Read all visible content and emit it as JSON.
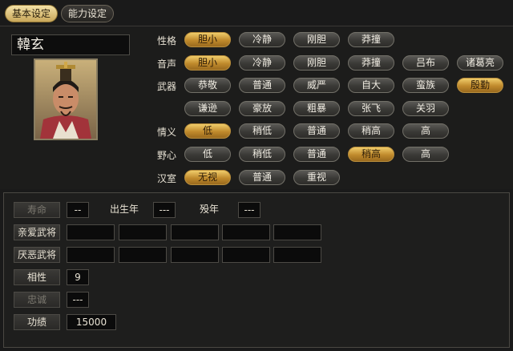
{
  "tabs": [
    {
      "label": "基本设定",
      "active": true
    },
    {
      "label": "能力设定",
      "active": false
    }
  ],
  "name": "韓玄",
  "portrait": "officer-portrait",
  "attributes": [
    {
      "label": "性格",
      "options": [
        {
          "text": "胆小",
          "selected": true
        },
        {
          "text": "冷静",
          "selected": false
        },
        {
          "text": "刚胆",
          "selected": false
        },
        {
          "text": "莽撞",
          "selected": false
        }
      ]
    },
    {
      "label": "音声",
      "options": [
        {
          "text": "胆小",
          "selected": true
        },
        {
          "text": "冷静",
          "selected": false
        },
        {
          "text": "刚胆",
          "selected": false
        },
        {
          "text": "莽撞",
          "selected": false
        },
        {
          "text": "吕布",
          "selected": false
        },
        {
          "text": "诸葛亮",
          "selected": false
        }
      ]
    },
    {
      "label": "武器",
      "options": [
        {
          "text": "恭敬",
          "selected": false
        },
        {
          "text": "普通",
          "selected": false
        },
        {
          "text": "威严",
          "selected": false
        },
        {
          "text": "自大",
          "selected": false
        },
        {
          "text": "蛮族",
          "selected": false
        },
        {
          "text": "殷勤",
          "selected": true
        }
      ]
    },
    {
      "label": "",
      "options": [
        {
          "text": "谦逊",
          "selected": false
        },
        {
          "text": "豪放",
          "selected": false
        },
        {
          "text": "粗暴",
          "selected": false
        },
        {
          "text": "张飞",
          "selected": false
        },
        {
          "text": "关羽",
          "selected": false
        }
      ]
    },
    {
      "label": "情义",
      "options": [
        {
          "text": "低",
          "selected": true
        },
        {
          "text": "稍低",
          "selected": false
        },
        {
          "text": "普通",
          "selected": false
        },
        {
          "text": "稍高",
          "selected": false
        },
        {
          "text": "高",
          "selected": false
        }
      ]
    },
    {
      "label": "野心",
      "options": [
        {
          "text": "低",
          "selected": false
        },
        {
          "text": "稍低",
          "selected": false
        },
        {
          "text": "普通",
          "selected": false
        },
        {
          "text": "稍高",
          "selected": true
        },
        {
          "text": "高",
          "selected": false
        }
      ]
    },
    {
      "label": "汉室",
      "options": [
        {
          "text": "无视",
          "selected": true
        },
        {
          "text": "普通",
          "selected": false
        },
        {
          "text": "重视",
          "selected": false
        }
      ]
    }
  ],
  "bottom": {
    "lifespan_label": "寿命",
    "lifespan_value": "--",
    "birth_label": "出生年",
    "birth_value": "---",
    "death_label": "殁年",
    "death_value": "---",
    "favored_label": "亲爱武将",
    "disliked_label": "厌恶武将",
    "compat_label": "相性",
    "compat_value": "9",
    "loyalty_label": "忠诚",
    "loyalty_value": "---",
    "merit_label": "功绩",
    "merit_value": "15000"
  }
}
